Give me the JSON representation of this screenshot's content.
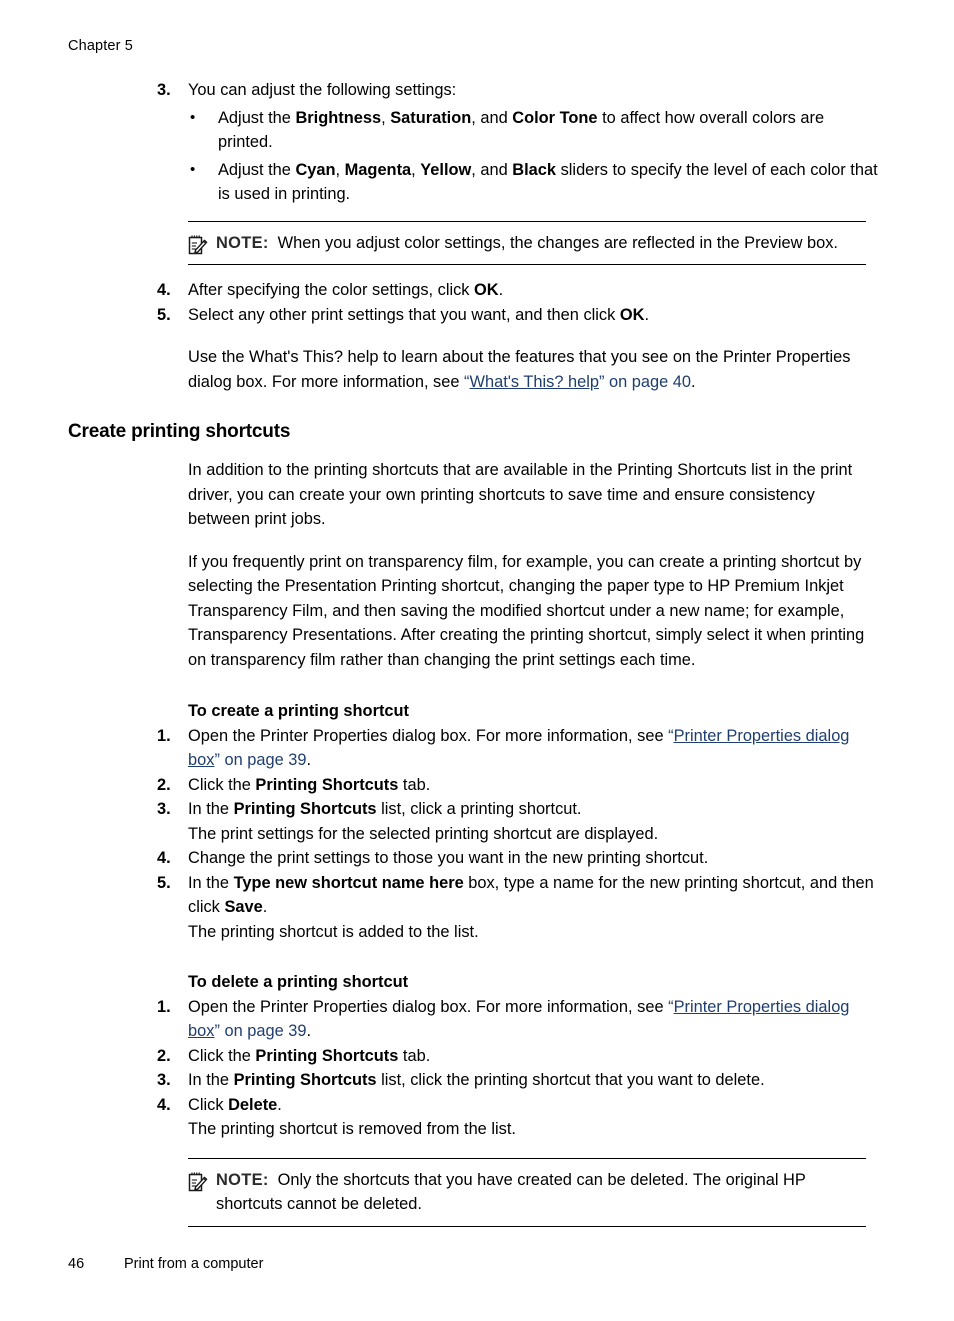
{
  "header": {
    "chapter": "Chapter 5"
  },
  "footer": {
    "page_number": "46",
    "section_title": "Print from a computer"
  },
  "steps_color": {
    "step3_num": "3.",
    "step3_text": "You can adjust the following settings:",
    "bullet_marker": "•",
    "bullet1": {
      "pre": "Adjust the ",
      "b1": "Brightness",
      "mid1": ", ",
      "b2": "Saturation",
      "mid2": ", and ",
      "b3": "Color Tone",
      "post": " to affect how overall colors are printed."
    },
    "bullet2": {
      "pre": "Adjust the ",
      "b1": "Cyan",
      "mid1": ", ",
      "b2": "Magenta",
      "mid2": ", ",
      "b3": "Yellow",
      "mid3": ", and ",
      "b4": "Black",
      "post": " sliders to specify the level of each color that is used in printing."
    },
    "note1": {
      "label": "NOTE:",
      "text": "When you adjust color settings, the changes are reflected in the Preview box.",
      "icon": "note-pencil-icon"
    },
    "step4_num": "4.",
    "step4_pre": "After specifying the color settings, click ",
    "step4_bold": "OK",
    "step4_post": ".",
    "step5_num": "5.",
    "step5_pre": "Select any other print settings that you want, and then click ",
    "step5_bold": "OK",
    "step5_post": ".",
    "closing_para": {
      "pre": "Use the What's This? help to learn about the features that you see on the Printer Properties dialog box. For more information, see ",
      "quote_open": "“",
      "link_text": "What's This? help",
      "quote_close": "”",
      "link_tail": " on page 40",
      "post": "."
    }
  },
  "section": {
    "heading": "Create printing shortcuts",
    "para1": "In addition to the printing shortcuts that are available in the Printing Shortcuts list in the print driver, you can create your own printing shortcuts to save time and ensure consistency between print jobs.",
    "para2": "If you frequently print on transparency film, for example, you can create a printing shortcut by selecting the Presentation Printing shortcut, changing the paper type to HP Premium Inkjet Transparency Film, and then saving the modified shortcut under a new name; for example, Transparency Presentations. After creating the printing shortcut, simply select it when printing on transparency film rather than changing the print settings each time."
  },
  "create_task": {
    "heading": "To create a printing shortcut",
    "step1": {
      "num": "1.",
      "pre": "Open the Printer Properties dialog box. For more information, see ",
      "quote_open": "“",
      "link_text": "Printer Properties dialog box",
      "quote_close": "”",
      "link_tail": " on page 39",
      "post": "."
    },
    "step2": {
      "num": "2.",
      "pre": "Click the ",
      "bold": "Printing Shortcuts",
      "post": " tab."
    },
    "step3": {
      "num": "3.",
      "pre": "In the ",
      "bold": "Printing Shortcuts",
      "post": " list, click a printing shortcut.",
      "result": "The print settings for the selected printing shortcut are displayed."
    },
    "step4": {
      "num": "4.",
      "text": "Change the print settings to those you want in the new printing shortcut."
    },
    "step5": {
      "num": "5.",
      "pre": "In the ",
      "bold1": "Type new shortcut name here",
      "mid": " box, type a name for the new printing shortcut, and then click ",
      "bold2": "Save",
      "post": ".",
      "result": "The printing shortcut is added to the list."
    }
  },
  "delete_task": {
    "heading": "To delete a printing shortcut",
    "step1": {
      "num": "1.",
      "pre": "Open the Printer Properties dialog box. For more information, see ",
      "quote_open": "“",
      "link_text": "Printer Properties dialog box",
      "quote_close": "”",
      "link_tail": " on page 39",
      "post": "."
    },
    "step2": {
      "num": "2.",
      "pre": "Click the ",
      "bold": "Printing Shortcuts",
      "post": " tab."
    },
    "step3": {
      "num": "3.",
      "pre": "In the ",
      "bold": "Printing Shortcuts",
      "post": " list, click the printing shortcut that you want to delete."
    },
    "step4": {
      "num": "4.",
      "pre": "Click ",
      "bold": "Delete",
      "post": ".",
      "result": "The printing shortcut is removed from the list."
    },
    "note": {
      "label": "NOTE:",
      "text": "Only the shortcuts that you have created can be deleted. The original HP shortcuts cannot be deleted.",
      "icon": "note-pencil-icon"
    }
  },
  "colors": {
    "link": "#1F3E6E",
    "text": "#000000",
    "note_label": "#2b2b2b"
  }
}
